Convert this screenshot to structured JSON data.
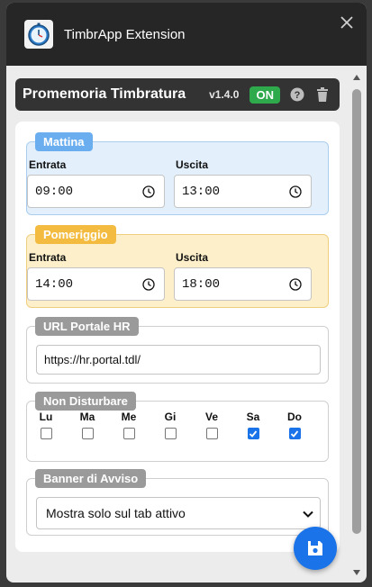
{
  "window": {
    "title": "TimbrApp Extension",
    "app_icon": "stopwatch-icon",
    "close_icon": "close-icon"
  },
  "header": {
    "title": "Promemoria Timbratura",
    "version": "v1.4.0",
    "status": "ON",
    "help_icon": "question-circle-icon",
    "delete_icon": "trash-icon"
  },
  "morning": {
    "legend": "Mattina",
    "entry_label": "Entrata",
    "entry_value": "09:00",
    "exit_label": "Uscita",
    "exit_value": "13:00",
    "color": "#6aaef0",
    "bg": "#e3f0fc",
    "border": "#a9cdef"
  },
  "afternoon": {
    "legend": "Pomeriggio",
    "entry_label": "Entrata",
    "entry_value": "14:00",
    "exit_label": "Uscita",
    "exit_value": "18:00",
    "color": "#f3bb3f",
    "bg": "#fdefc9",
    "border": "#efcf7f"
  },
  "hr_portal": {
    "legend": "URL Portale HR",
    "value": "https://hr.portal.tdl/"
  },
  "do_not_disturb": {
    "legend": "Non Disturbare",
    "days": [
      {
        "label": "Lu",
        "checked": false
      },
      {
        "label": "Ma",
        "checked": false
      },
      {
        "label": "Me",
        "checked": false
      },
      {
        "label": "Gi",
        "checked": false
      },
      {
        "label": "Ve",
        "checked": false
      },
      {
        "label": "Sa",
        "checked": true
      },
      {
        "label": "Do",
        "checked": true
      }
    ]
  },
  "banner": {
    "legend": "Banner di Avviso",
    "selected": "Mostra solo sul tab attivo"
  },
  "save_icon": "floppy-disk-icon",
  "colors": {
    "accent": "#1a73e8",
    "on_badge": "#2eaa4d",
    "legend_gray": "#9a9a9a"
  }
}
